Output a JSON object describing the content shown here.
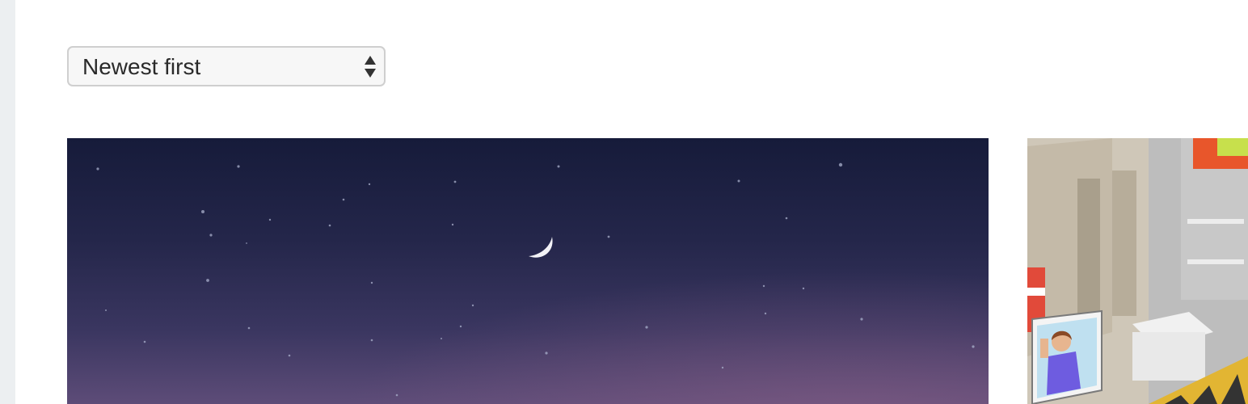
{
  "sort": {
    "selected": "Newest first"
  },
  "icons": {
    "sort_arrows": "up-down-arrows-icon",
    "moon": "crescent-moon-icon"
  },
  "colors": {
    "rail": "#eceff1",
    "select_border": "#cfcfcf",
    "select_background": "#f7f7f7",
    "night_sky_top": "#161b3a",
    "night_sky_bottom": "#5d4c78"
  }
}
